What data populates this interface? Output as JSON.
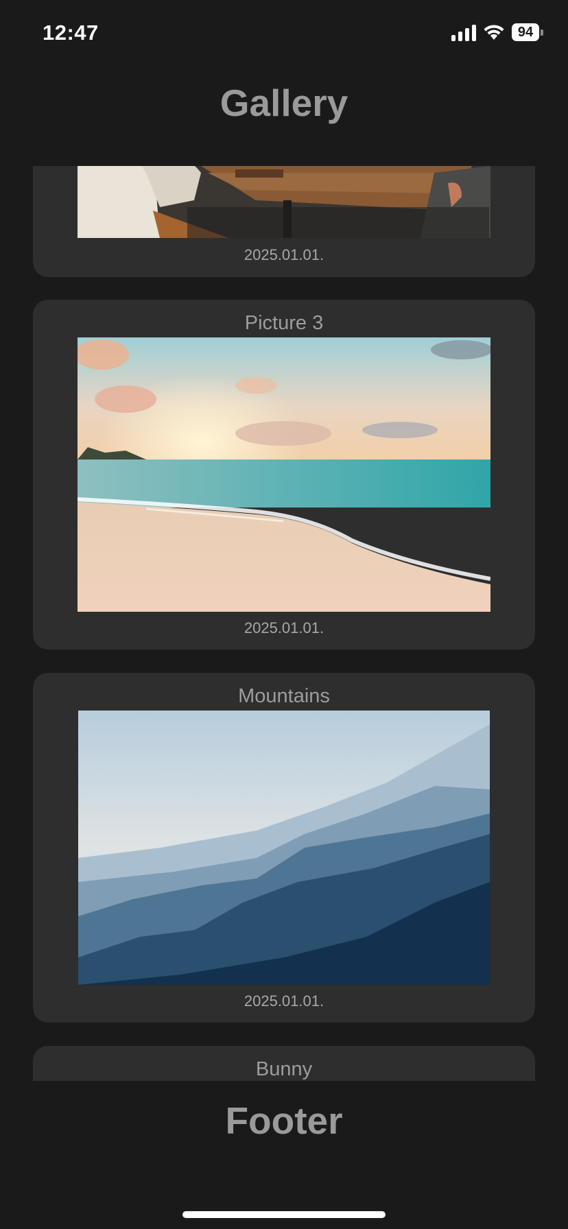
{
  "status_bar": {
    "time": "12:47",
    "battery_level": "94",
    "signal_icon": "cellular-signal-icon",
    "wifi_icon": "wifi-icon"
  },
  "header": {
    "title": "Gallery"
  },
  "gallery": {
    "cards": [
      {
        "title": "",
        "date": "2025.01.01.",
        "image": "cafe-table-photo"
      },
      {
        "title": "Picture 3",
        "date": "2025.01.01.",
        "image": "beach-sunset-photo"
      },
      {
        "title": "Mountains",
        "date": "2025.01.01.",
        "image": "misty-mountains-photo"
      },
      {
        "title": "Bunny",
        "date": "",
        "image": ""
      }
    ]
  },
  "footer": {
    "title": "Footer"
  },
  "colors": {
    "background": "#1a1a1a",
    "card": "#2e2e2e",
    "header_text": "#9a9a9a",
    "card_text": "#9d9d9d"
  }
}
